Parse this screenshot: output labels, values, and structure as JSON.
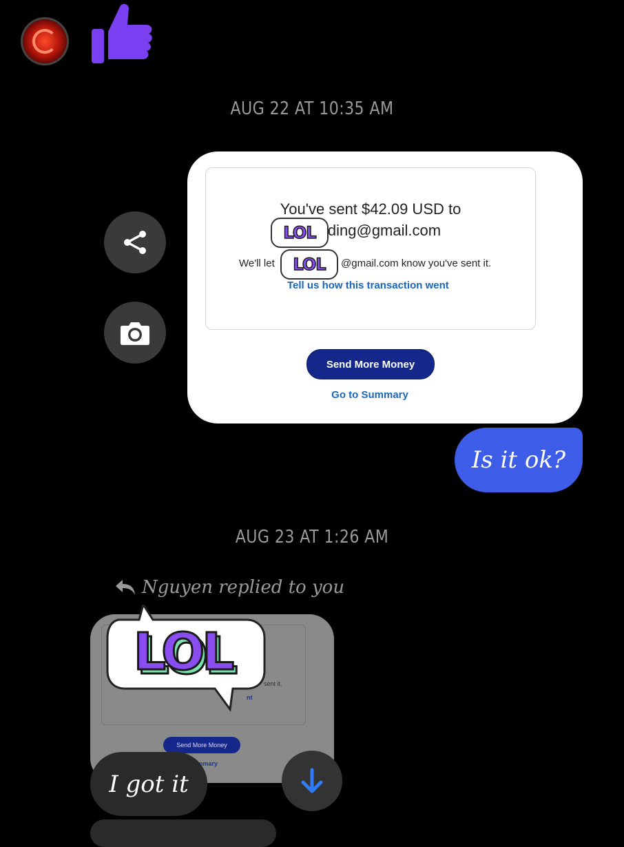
{
  "header": {
    "thumb_icon": "thumbs-up-icon",
    "thumb_color": "#7b3ff2"
  },
  "timestamps": {
    "first": "AUG 22 AT 10:35 AM",
    "second": "AUG 23 AT 1:26 AM"
  },
  "side_actions": {
    "share_icon": "share-icon",
    "camera_icon": "camera-icon"
  },
  "paypal_card": {
    "line1": "You've sent $42.09 USD to",
    "line2": "lding@gmail.com",
    "notify_left": "We'll let",
    "notify_right": "@gmail.com know you've sent it.",
    "feedback_link": "Tell us how this transaction went",
    "send_more": "Send More Money",
    "go_summary": "Go to Summary",
    "sticker_text": "LOL"
  },
  "outgoing_message": {
    "text": "Is it ok?",
    "color": "#3d5ce8"
  },
  "reply": {
    "label": "Nguyen replied to you",
    "preview_sent_it": "sent it.",
    "preview_link": "nt",
    "preview_send_more": "Send More Money",
    "preview_summary": "ummary",
    "sticker_text": "LOL"
  },
  "incoming_message": {
    "text": "I got it"
  },
  "colors": {
    "background": "#000000",
    "sticker_purple": "#8a4df0",
    "sticker_green": "#7de0b0",
    "paypal_blue": "#13288a",
    "link_blue": "#1a66b8"
  }
}
